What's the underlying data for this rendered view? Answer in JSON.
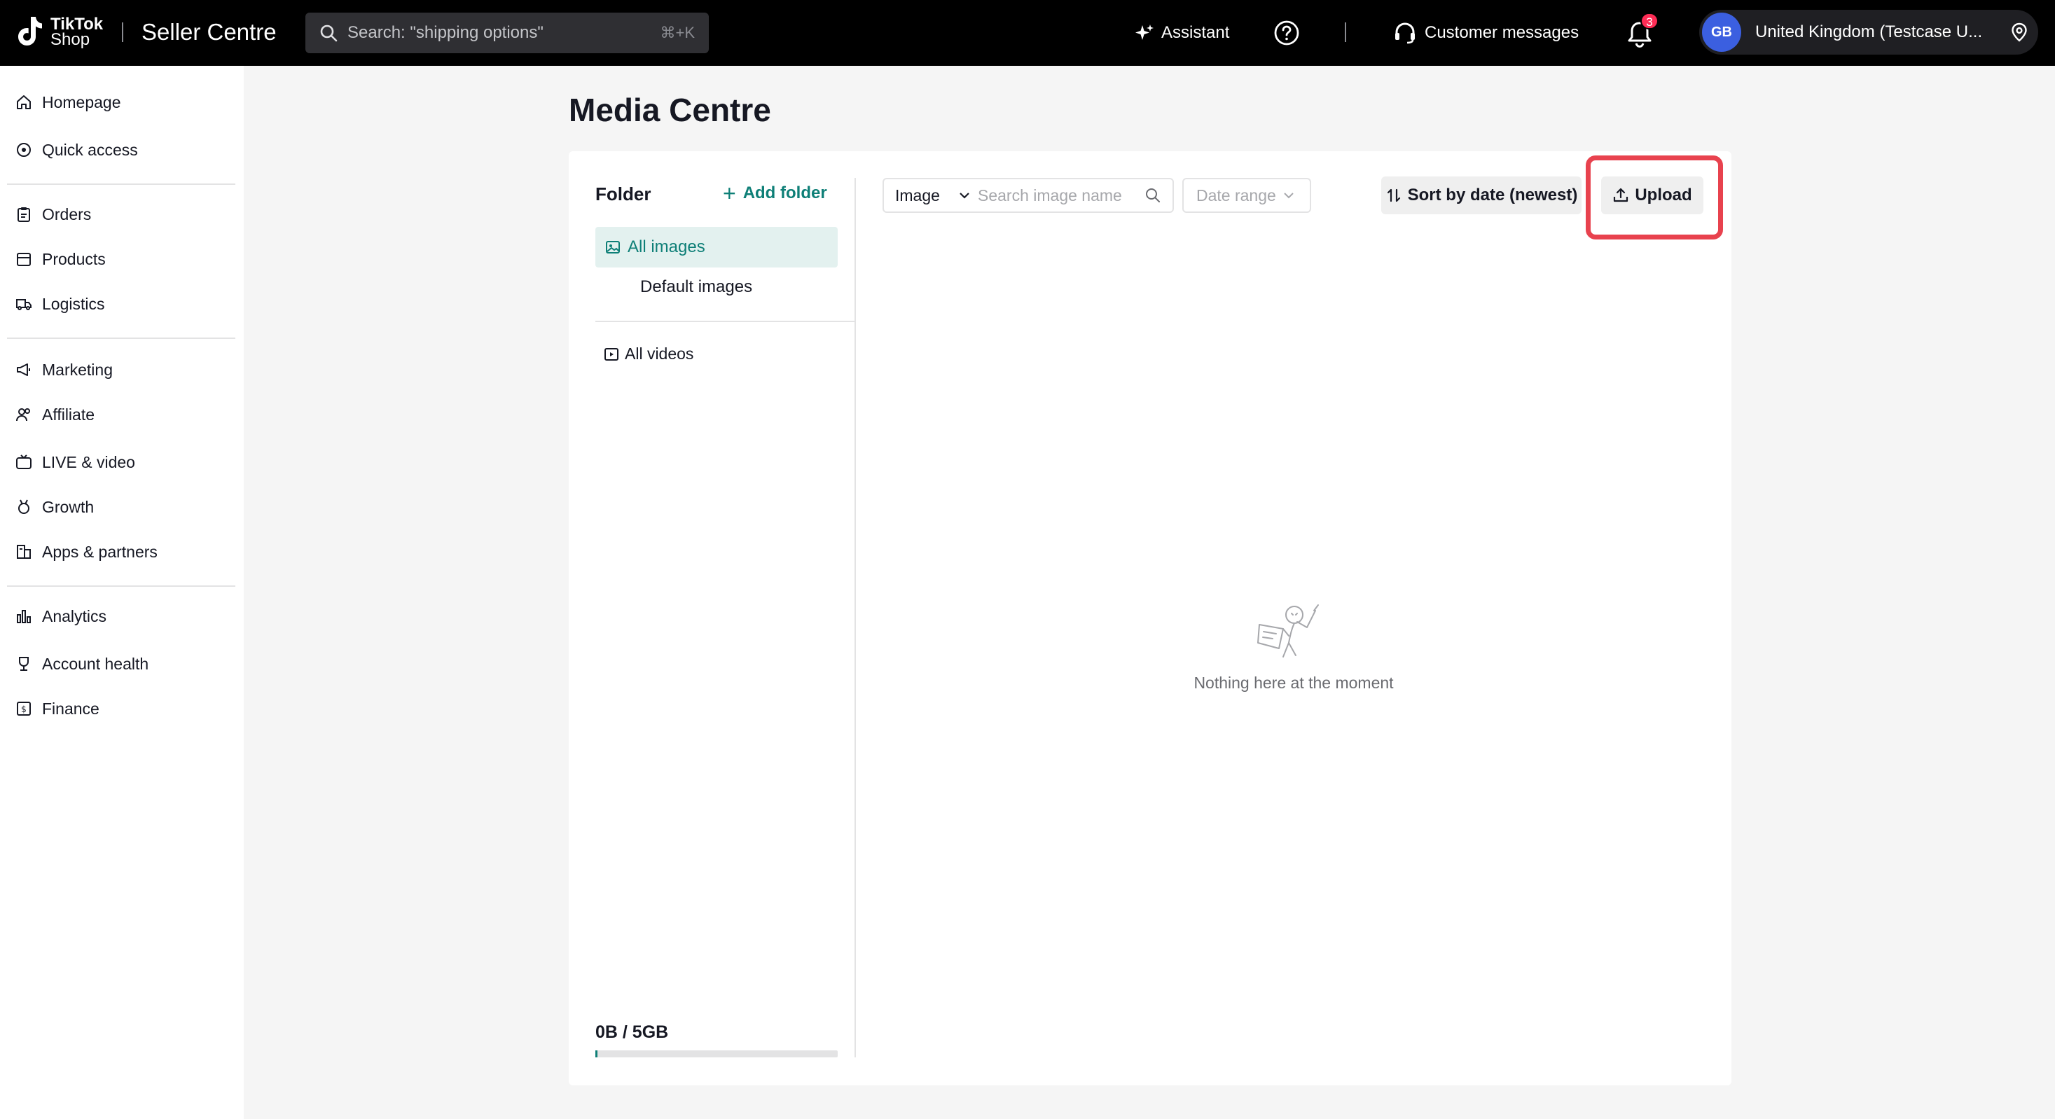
{
  "header": {
    "logo_line1": "TikTok",
    "logo_line2": "Shop",
    "app_title": "Seller Centre",
    "search_placeholder": "Search: \"shipping options\"",
    "search_shortcut": "⌘+K",
    "assistant_label": "Assistant",
    "customer_messages_label": "Customer messages",
    "notification_count": "3",
    "avatar_initials": "GB",
    "account_name": "United Kingdom  (Testcase U..."
  },
  "sidebar": {
    "items": [
      {
        "label": "Homepage",
        "icon": "home-icon"
      },
      {
        "label": "Quick access",
        "icon": "compass-icon"
      },
      {
        "label": "Orders",
        "icon": "clipboard-icon"
      },
      {
        "label": "Products",
        "icon": "box-icon"
      },
      {
        "label": "Logistics",
        "icon": "truck-icon"
      },
      {
        "label": "Marketing",
        "icon": "megaphone-icon"
      },
      {
        "label": "Affiliate",
        "icon": "people-icon"
      },
      {
        "label": "LIVE & video",
        "icon": "live-icon"
      },
      {
        "label": "Growth",
        "icon": "medal-icon"
      },
      {
        "label": "Apps & partners",
        "icon": "building-icon"
      },
      {
        "label": "Analytics",
        "icon": "bar-chart-icon"
      },
      {
        "label": "Account health",
        "icon": "trophy-icon"
      },
      {
        "label": "Finance",
        "icon": "finance-icon"
      }
    ]
  },
  "main": {
    "page_title": "Media Centre",
    "folder_title": "Folder",
    "add_folder_label": "Add folder",
    "folders": {
      "all_images": "All images",
      "default_images": "Default images",
      "all_videos": "All videos"
    },
    "storage_text": "0B / 5GB",
    "storage_used_fraction": 0.0,
    "type_select_value": "Image",
    "search_image_placeholder": "Search image name",
    "date_range_placeholder": "Date range",
    "sort_label": "Sort by date (newest)",
    "upload_label": "Upload",
    "empty_text": "Nothing here at the moment"
  },
  "colors": {
    "accent_teal": "#0e7f77",
    "highlight_red": "#e8424e",
    "badge_red": "#fe2c55",
    "avatar_blue": "#3b5fe0"
  }
}
